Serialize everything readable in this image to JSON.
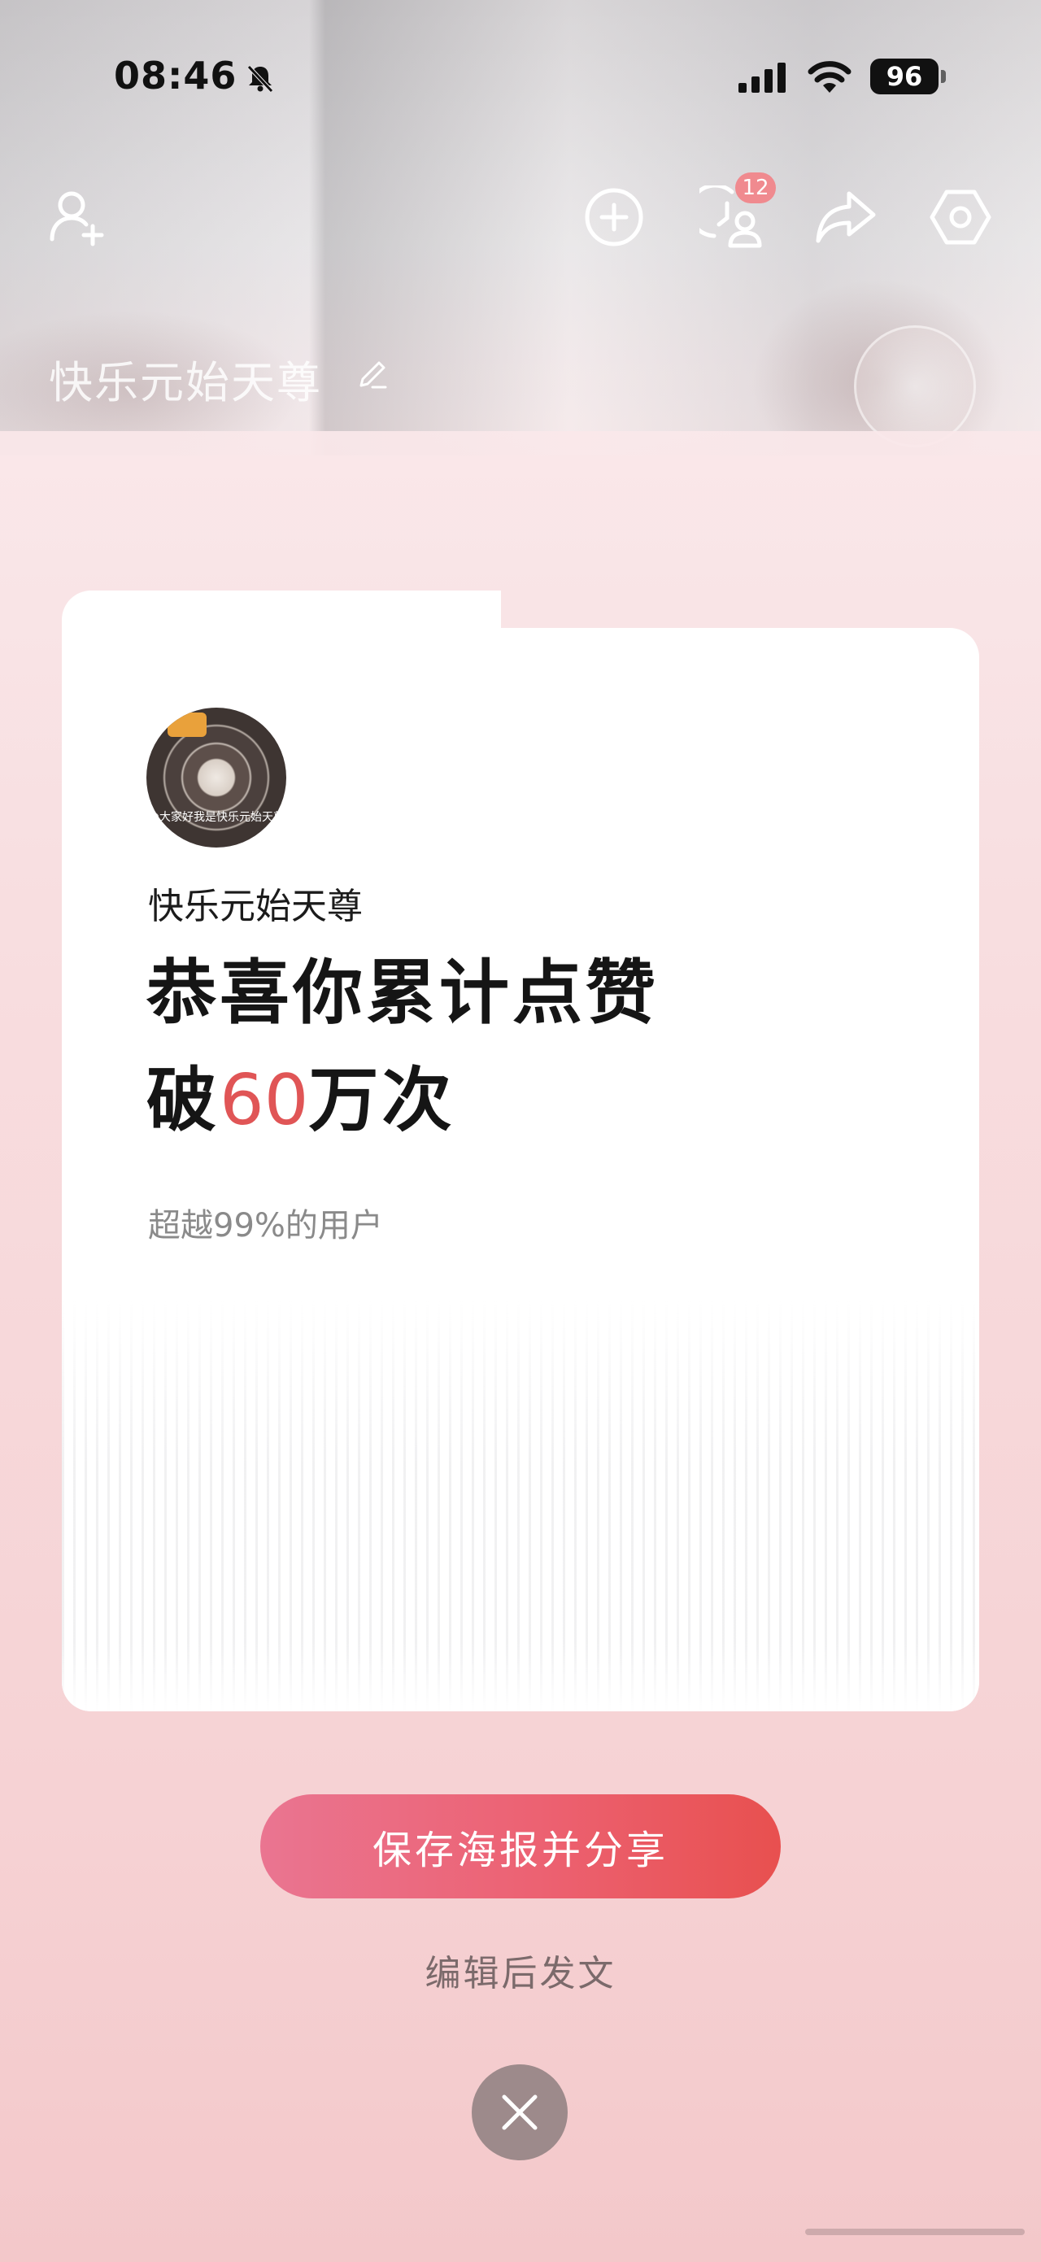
{
  "status_bar": {
    "time": "08:46",
    "battery": "96"
  },
  "header": {
    "badge_count": "12",
    "username": "快乐元始天尊"
  },
  "card": {
    "avatar_caption": "@大家好我是快乐元始天尊",
    "username": "快乐元始天尊",
    "title_line1": "恭喜你累计点赞",
    "title_prefix": "破",
    "title_number": "60",
    "title_suffix": "万次",
    "subtitle": "超越99%的用户"
  },
  "actions": {
    "save_share": "保存海报并分享",
    "edit_post": "编辑后发文"
  },
  "colors": {
    "accent": "#e05556",
    "button_start": "#ea7591",
    "button_end": "#e8504f"
  },
  "icons": [
    "add-friend-icon",
    "plus-circle-icon",
    "visitor-history-icon",
    "share-icon",
    "settings-icon",
    "edit-icon",
    "close-icon",
    "bell-muted-icon",
    "signal-icon",
    "wifi-icon"
  ]
}
